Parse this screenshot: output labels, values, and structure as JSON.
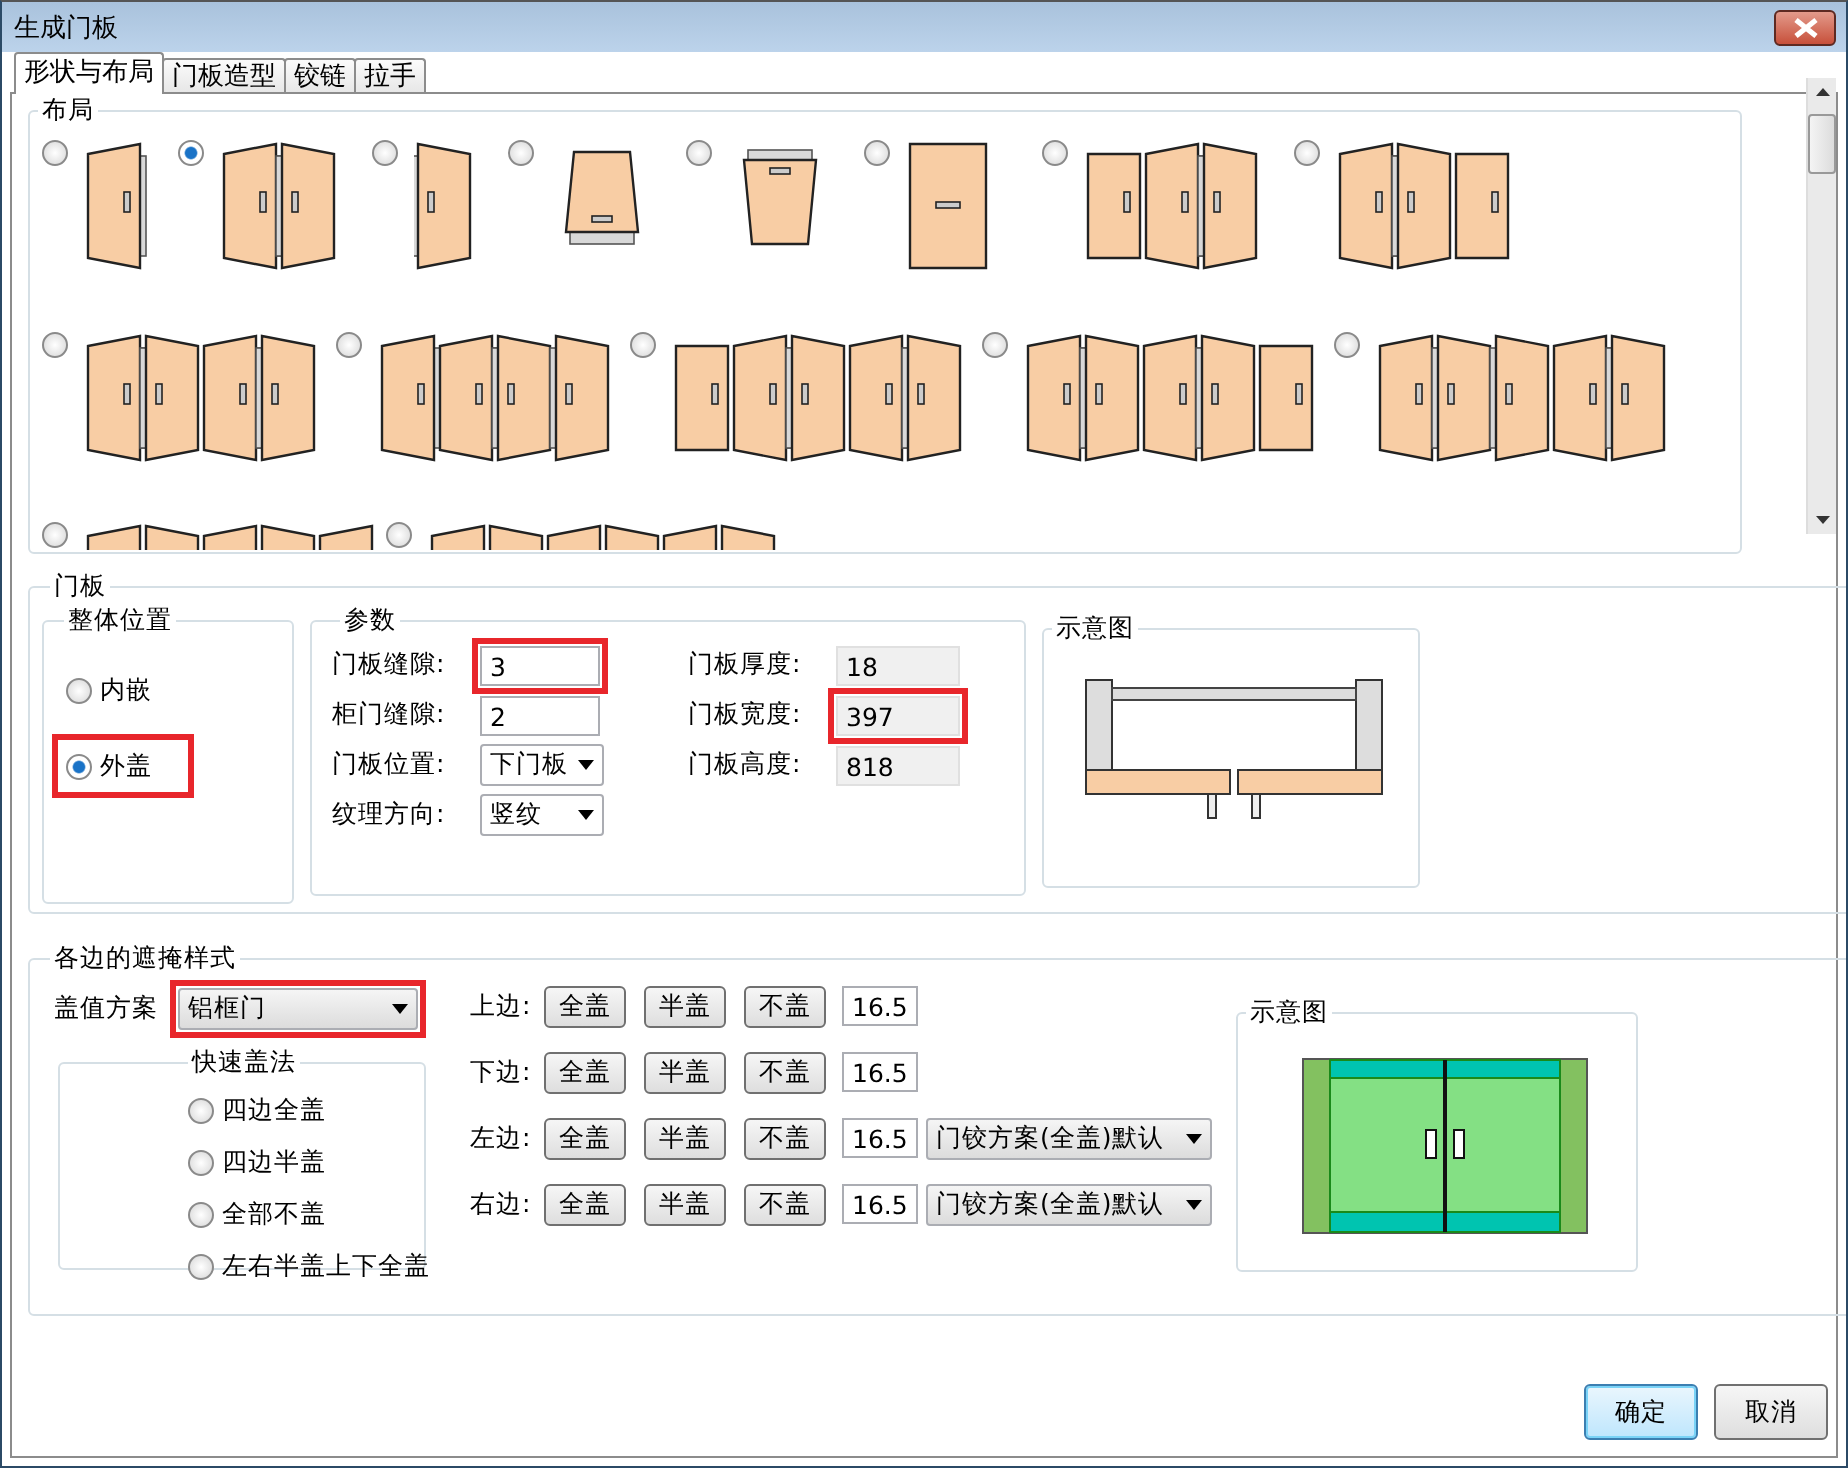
{
  "window": {
    "title": "生成门板"
  },
  "tabs": [
    {
      "label": "形状与布局",
      "selected": true
    },
    {
      "label": "门板造型",
      "selected": false
    },
    {
      "label": "铰链",
      "selected": false
    },
    {
      "label": "拉手",
      "selected": false
    }
  ],
  "layout": {
    "title": "布局",
    "options": [
      {
        "selected": false
      },
      {
        "selected": true
      },
      {
        "selected": false
      },
      {
        "selected": false
      },
      {
        "selected": false
      },
      {
        "selected": false
      },
      {
        "selected": false
      },
      {
        "selected": false
      },
      {
        "selected": false
      },
      {
        "selected": false
      },
      {
        "selected": false
      },
      {
        "selected": false
      },
      {
        "selected": false
      },
      {
        "selected": false
      },
      {
        "selected": false
      }
    ]
  },
  "door_panel": {
    "title": "门板",
    "position": {
      "title": "整体位置",
      "options": [
        {
          "label": "内嵌",
          "selected": false,
          "highlighted": false
        },
        {
          "label": "外盖",
          "selected": true,
          "highlighted": true
        }
      ]
    },
    "params": {
      "title": "参数",
      "fields": [
        {
          "label": "门板缝隙:",
          "value": "3",
          "kind": "input",
          "highlighted": true
        },
        {
          "label": "柜门缝隙:",
          "value": "2",
          "kind": "input",
          "highlighted": false
        },
        {
          "label": "门板位置:",
          "value": "下门板",
          "kind": "select",
          "highlighted": false
        },
        {
          "label": "纹理方向:",
          "value": "竖纹",
          "kind": "select",
          "highlighted": false
        }
      ],
      "readouts": [
        {
          "label": "门板厚度:",
          "value": "18",
          "kind": "readonly",
          "highlighted": false
        },
        {
          "label": "门板宽度:",
          "value": "397",
          "kind": "readonly",
          "highlighted": true
        },
        {
          "label": "门板高度:",
          "value": "818",
          "kind": "readonly",
          "highlighted": false
        }
      ]
    },
    "preview": {
      "title": "示意图"
    }
  },
  "edge_cover": {
    "title": "各边的遮掩样式",
    "scheme": {
      "label": "盖值方案",
      "value": "铝框门",
      "highlighted": true
    },
    "quick": {
      "title": "快速盖法",
      "options": [
        {
          "label": "四边全盖",
          "selected": false
        },
        {
          "label": "四边半盖",
          "selected": false
        },
        {
          "label": "全部不盖",
          "selected": false
        },
        {
          "label": "左右半盖上下全盖",
          "selected": false
        }
      ]
    },
    "edges": [
      {
        "label": "上边:",
        "buttons": [
          "全盖",
          "半盖",
          "不盖"
        ],
        "value": "16.5"
      },
      {
        "label": "下边:",
        "buttons": [
          "全盖",
          "半盖",
          "不盖"
        ],
        "value": "16.5"
      },
      {
        "label": "左边:",
        "buttons": [
          "全盖",
          "半盖",
          "不盖"
        ],
        "value": "16.5",
        "hinge": "门铰方案(全盖)默认"
      },
      {
        "label": "右边:",
        "buttons": [
          "全盖",
          "半盖",
          "不盖"
        ],
        "value": "16.5",
        "hinge": "门铰方案(全盖)默认"
      }
    ],
    "preview": {
      "title": "示意图"
    }
  },
  "buttons": [
    {
      "label": "确定",
      "default": true
    },
    {
      "label": "取消",
      "default": false
    }
  ]
}
